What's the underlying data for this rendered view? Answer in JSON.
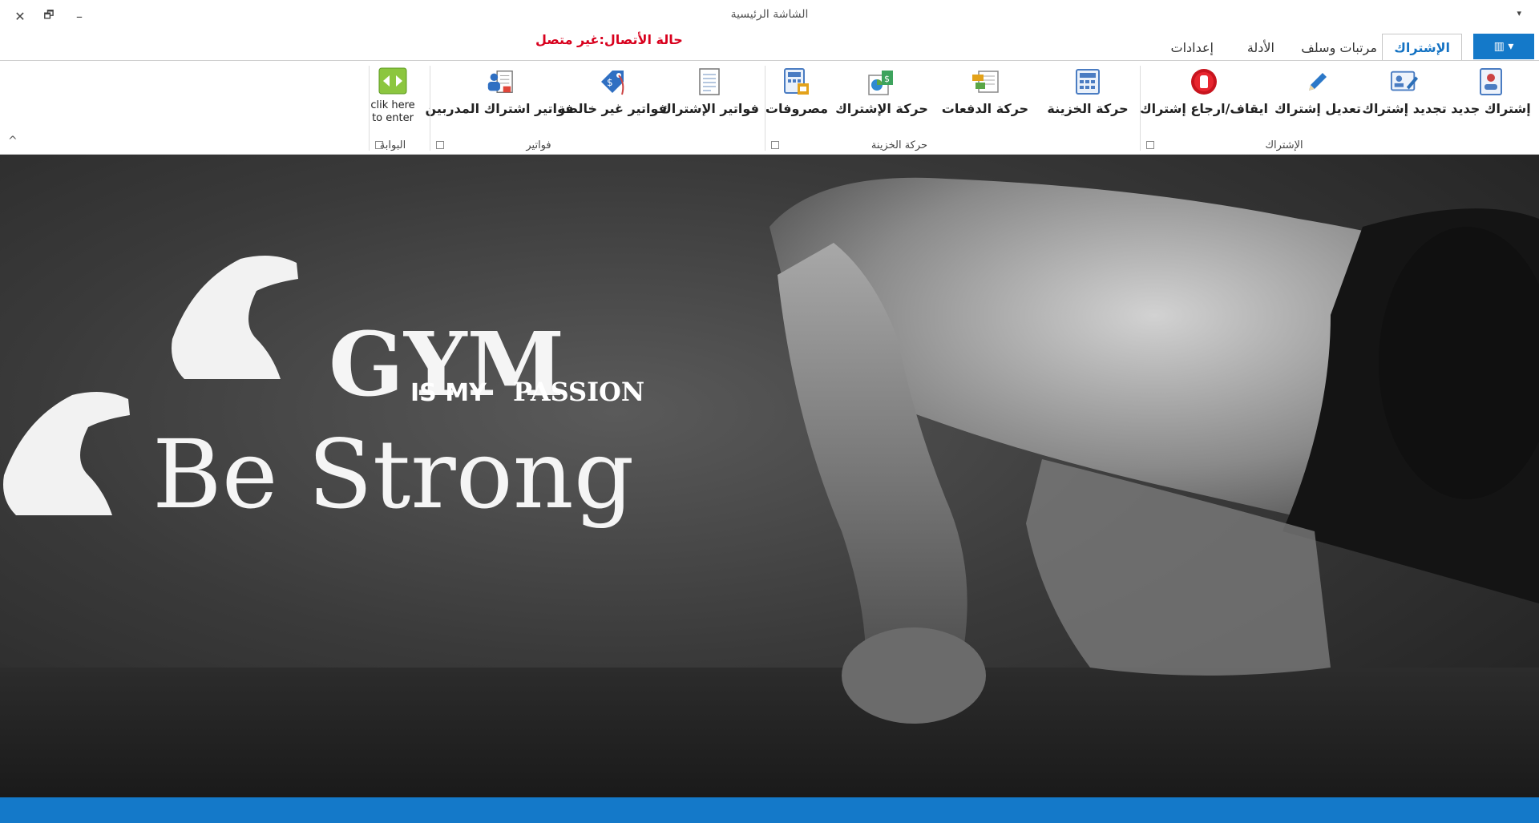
{
  "window": {
    "title": "الشاشة الرئيسية",
    "close_glyph": "✕",
    "restore_glyph": "🗗",
    "minimize_glyph": "–",
    "qat_glyph": "▾"
  },
  "tabs": {
    "app_menu_glyph": "▥ ▾",
    "items": [
      {
        "label": "الإشتراك",
        "active": true
      },
      {
        "label": "مرتبات وسلف",
        "active": false
      },
      {
        "label": "الأدلة",
        "active": false
      },
      {
        "label": "إعدادات",
        "active": false
      }
    ]
  },
  "connection_status": "حالة الأتصال:غير متصل",
  "ribbon": {
    "groups": {
      "subscription": "الإشتراك",
      "treasury": "حركة الخزينة",
      "invoices": "فواتير",
      "gate": "البوابة"
    },
    "buttons": {
      "new_subscription": "إشتراك جديد",
      "renew_subscription": "تجديد إشتراك",
      "edit_subscription": "تعديل إشتراك",
      "stop_resume_subscription": "ايقاف/ارجاع إشتراك",
      "treasury_movement": "حركة الخزينة",
      "payments_movement": "حركة الدفعات",
      "subscription_movement": "حركة الإشتراك",
      "expenses": "مصروفات",
      "subscription_invoices": "فواتير الإشتراك",
      "unpaid_invoices": "فواتير غير خالصة",
      "trainers_invoices": "فواتير اشتراك المدربين",
      "gate_enter": "clik here to enter"
    },
    "collapse_glyph": "^"
  },
  "hero": {
    "logo_line1": "GYM",
    "logo_line2_a": "IS MY",
    "logo_line2_b": "PASSION",
    "slogan": "Be Strong"
  },
  "colors": {
    "accent": "#1479c9",
    "status_red": "#d8001d"
  }
}
